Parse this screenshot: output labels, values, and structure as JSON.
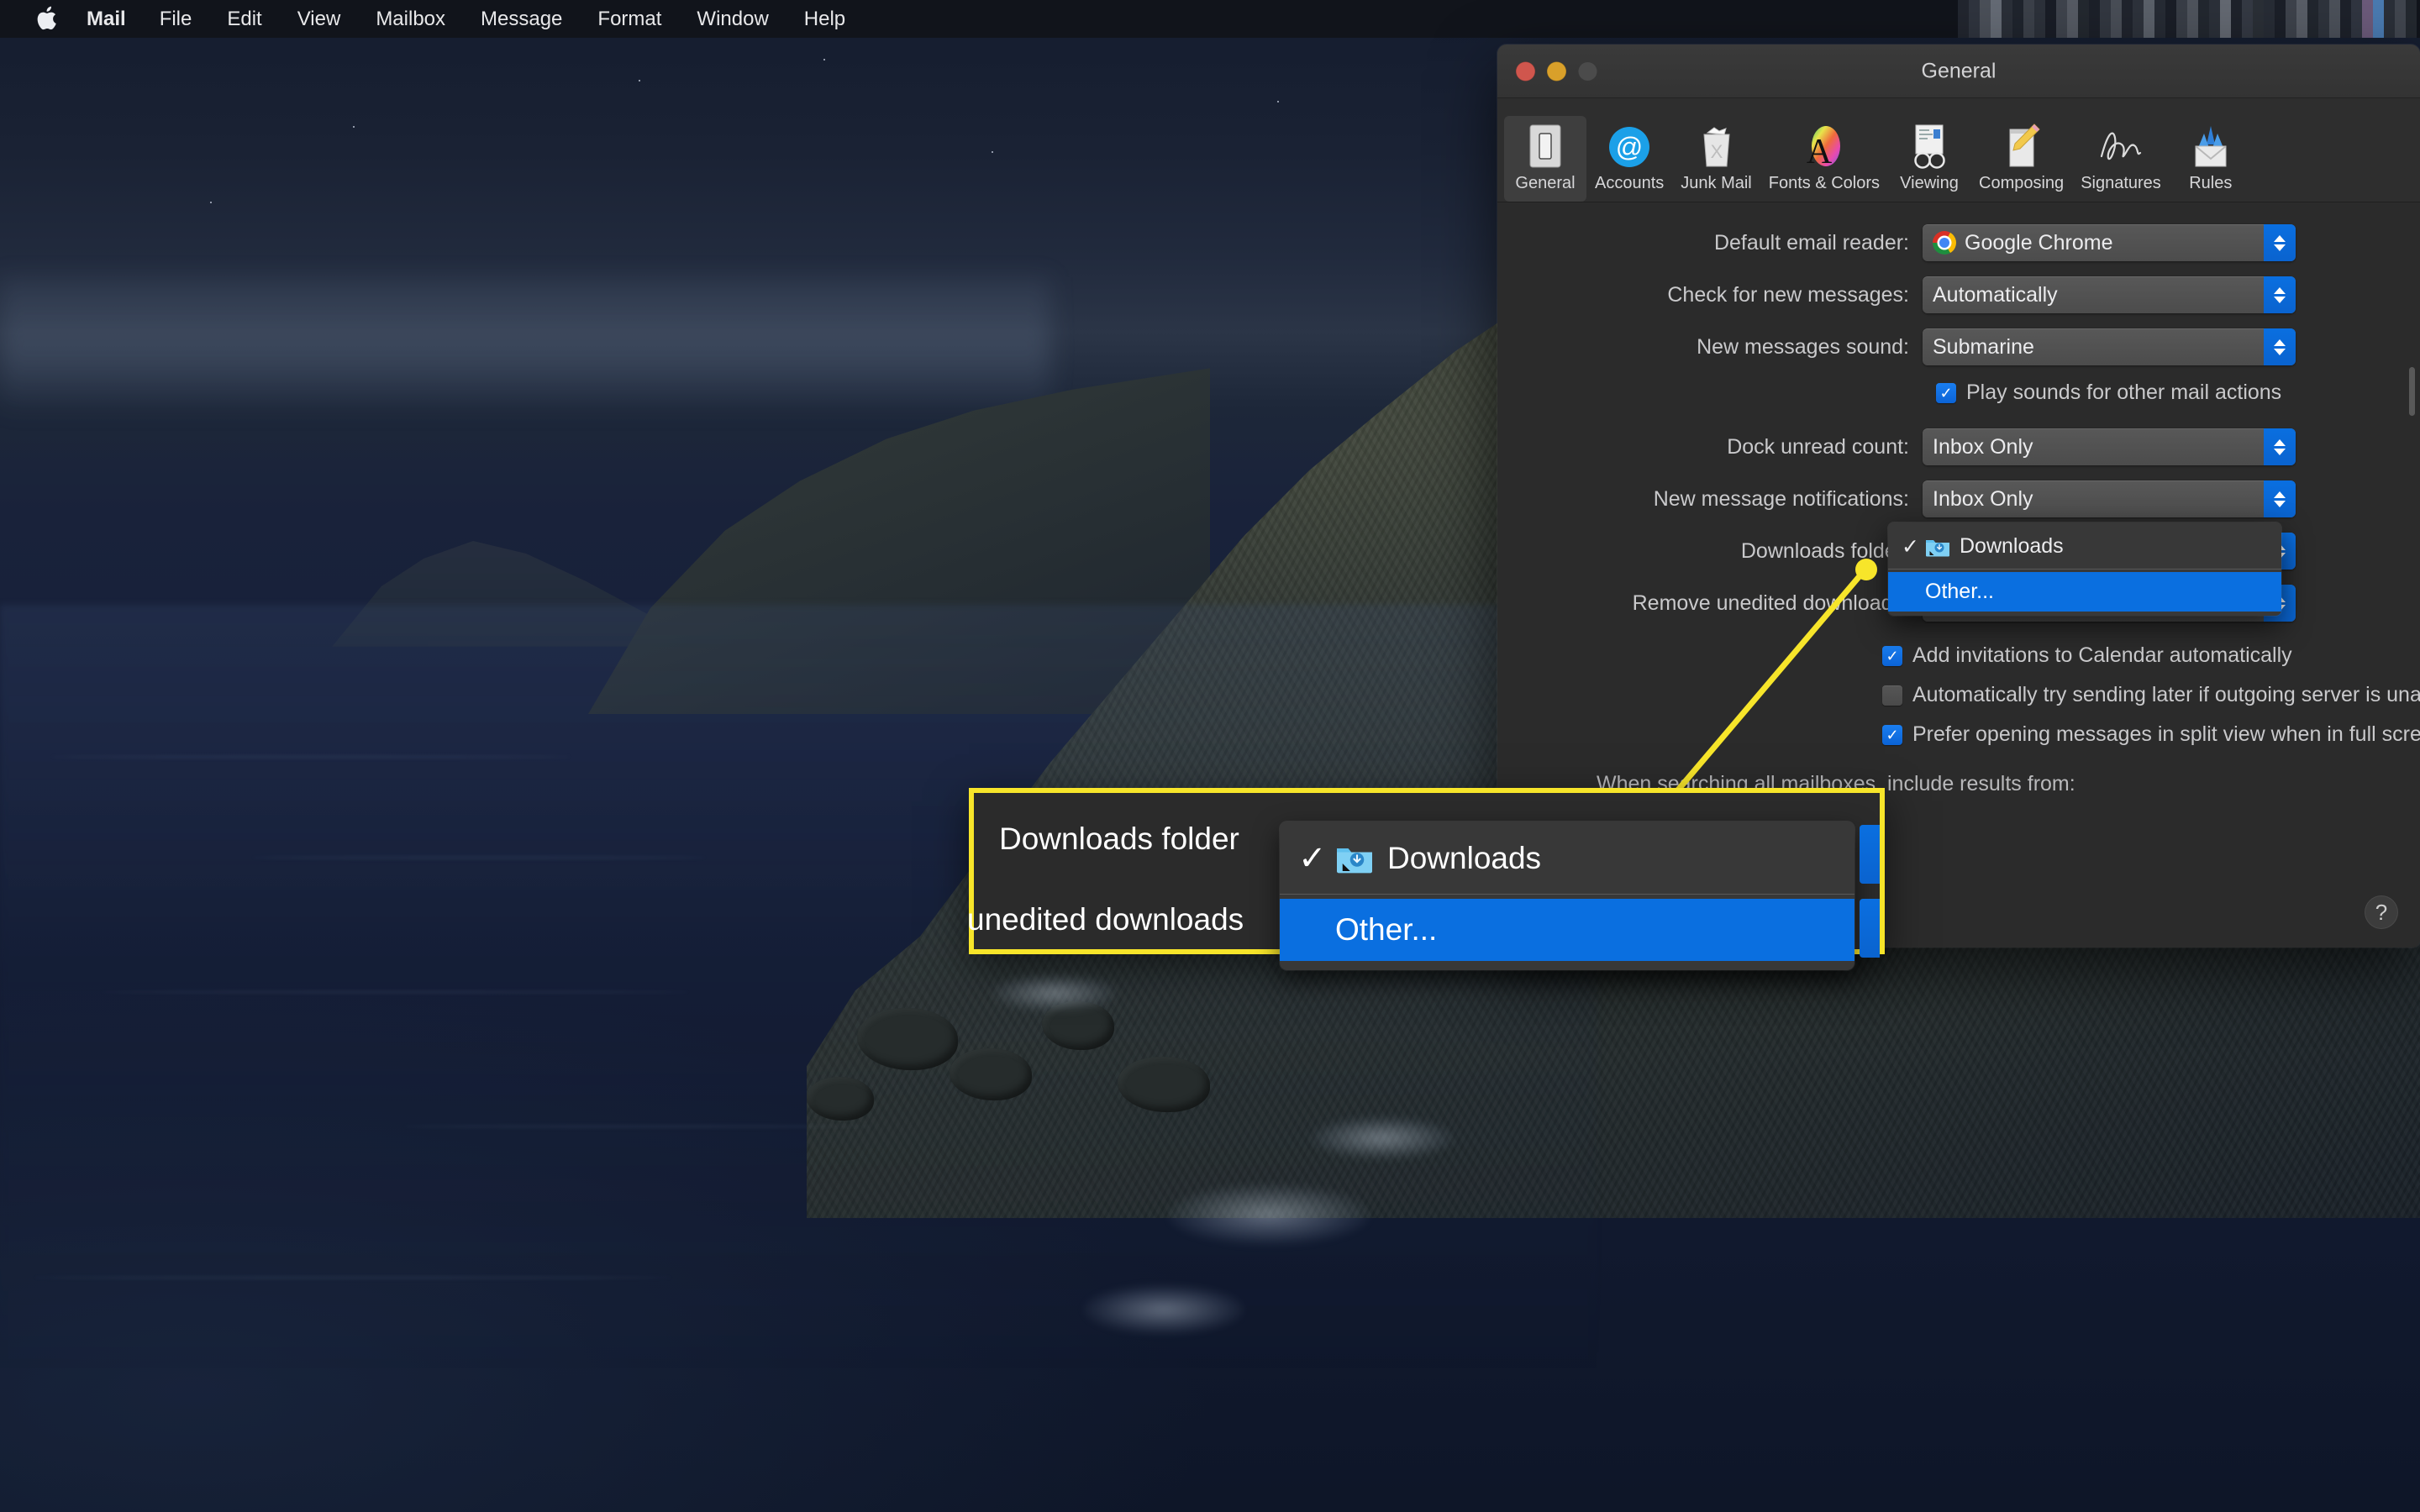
{
  "menubar": {
    "apple_icon": "apple-logo-icon",
    "items": [
      {
        "label": "Mail",
        "bold": true
      },
      {
        "label": "File",
        "bold": false
      },
      {
        "label": "Edit",
        "bold": false
      },
      {
        "label": "View",
        "bold": false
      },
      {
        "label": "Mailbox",
        "bold": false
      },
      {
        "label": "Message",
        "bold": false
      },
      {
        "label": "Format",
        "bold": false
      },
      {
        "label": "Window",
        "bold": false
      },
      {
        "label": "Help",
        "bold": false
      }
    ],
    "status_area": "redacted-status-icons"
  },
  "prefs_window": {
    "title": "General",
    "traffic_lights": {
      "close": "close-button",
      "minimize": "minimize-button",
      "zoom": "zoom-button-disabled"
    },
    "toolbar": [
      {
        "label": "General",
        "icon": "general-switch-icon",
        "selected": true
      },
      {
        "label": "Accounts",
        "icon": "at-sign-icon",
        "selected": false
      },
      {
        "label": "Junk Mail",
        "icon": "trash-can-icon",
        "selected": false
      },
      {
        "label": "Fonts & Colors",
        "icon": "font-palette-icon",
        "selected": false
      },
      {
        "label": "Viewing",
        "icon": "glasses-icon",
        "selected": false
      },
      {
        "label": "Composing",
        "icon": "pencil-paper-icon",
        "selected": false
      },
      {
        "label": "Signatures",
        "icon": "signature-icon",
        "selected": false
      },
      {
        "label": "Rules",
        "icon": "envelope-rules-icon",
        "selected": false
      }
    ],
    "rows": [
      {
        "label": "Default email reader:",
        "value": "Google Chrome",
        "icon": "chrome-icon"
      },
      {
        "label": "Check for new messages:",
        "value": "Automatically",
        "icon": ""
      },
      {
        "label": "New messages sound:",
        "value": "Submarine",
        "icon": ""
      }
    ],
    "sound_checkbox": {
      "label": "Play sounds for other mail actions",
      "checked": true
    },
    "rows2": [
      {
        "label": "Dock unread count:",
        "value": "Inbox Only"
      },
      {
        "label": "New message notifications:",
        "value": "Inbox Only"
      }
    ],
    "downloads_label": "Downloads folder:",
    "remove_label": "Remove unedited downloads:",
    "checkboxes": [
      {
        "label": "Add invitations to Calendar automatically",
        "checked": true
      },
      {
        "label": "Automatically try sending later if outgoing server is unavailable",
        "checked": false
      },
      {
        "label": "Prefer opening messages in split view when in full screen",
        "checked": true
      }
    ],
    "search_section_label": "When searching all mailboxes, include results from:",
    "help_button": "?"
  },
  "dropdown": {
    "items": [
      {
        "label": "Downloads",
        "checked": true,
        "highlighted": false,
        "icon": "downloads-folder-icon"
      },
      {
        "label": "Other...",
        "checked": false,
        "highlighted": true,
        "icon": ""
      }
    ]
  },
  "callout": {
    "border_color": "#f7e52a",
    "left_label_top": "Downloads folder",
    "left_label_bottom": "unedited downloads",
    "menu_items": [
      {
        "label": "Downloads",
        "checked": true,
        "highlighted": false,
        "icon": "downloads-folder-icon"
      },
      {
        "label": "Other...",
        "checked": false,
        "highlighted": true,
        "icon": ""
      }
    ]
  }
}
